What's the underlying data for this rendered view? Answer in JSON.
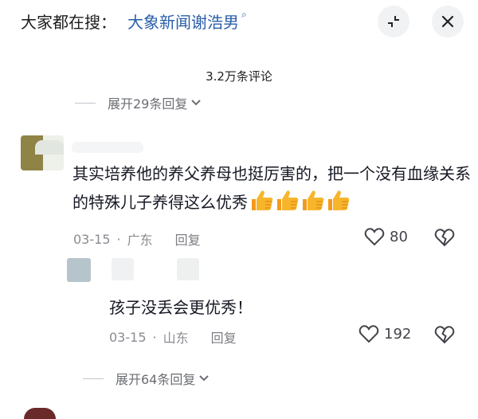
{
  "header": {
    "prefix": "大家都在搜：",
    "search_term": "大象新闻谢浩男",
    "search_icon": "search-icon",
    "minimize_icon": "minimize-icon",
    "close_icon": "close-icon"
  },
  "comments_count": "3.2万条评论",
  "expand_top": "展开29条回复",
  "comment": {
    "text": "其实培养他的养父养母也挺厉害的，把一个没有血缘关系的特殊儿子养得这么优秀",
    "emoji": "thumbs-up-icon",
    "emoji_count": 4,
    "date": "03-15",
    "location": "广东",
    "reply_label": "回复",
    "likes": "80"
  },
  "reply": {
    "text": "孩子没丢会更优秀！",
    "date": "03-15",
    "location": "山东",
    "reply_label": "回复",
    "likes": "192"
  },
  "expand_bottom": "展开64条回复",
  "colors": {
    "link": "#2a5ea8",
    "text": "#161823",
    "muted": "#8a8b91",
    "thumb": "#f5b626"
  }
}
